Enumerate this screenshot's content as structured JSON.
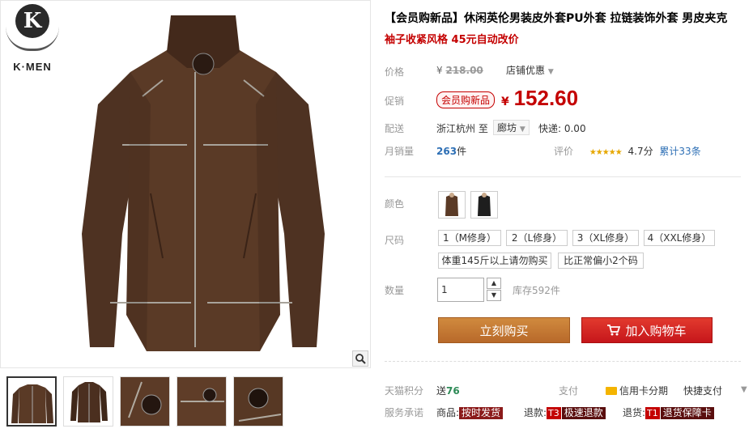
{
  "brand": {
    "logo_letter": "K",
    "logo_text": "K·MEN"
  },
  "product": {
    "title": "【会员购新品】休闲英伦男装皮外套PU外套 拉链装饰外套 男皮夹克",
    "subtitle": "袖子收紧风格 45元自动改价"
  },
  "price": {
    "orig_label": "价格",
    "currency": "¥",
    "orig_value": "218.00",
    "shop_discount": "店铺优惠",
    "promo_label": "促销",
    "promo_tag": "会员购新品",
    "promo_value": "152.60"
  },
  "shipping": {
    "label": "配送",
    "from": "浙江杭州",
    "to_word": "至",
    "to": "廊坊",
    "fee": "快递: 0.00"
  },
  "sales": {
    "label": "月销量",
    "count": "263",
    "unit": "件",
    "rating_label": "评价",
    "stars": "★★★★★",
    "score": "4.7分",
    "reviews": "累计33条"
  },
  "options": {
    "color_label": "颜色",
    "size_label": "尺码",
    "sizes": [
      "1（M修身）",
      "2（L修身）",
      "3（XL修身）",
      "4（XXL修身）",
      "体重145斤以上请勿购买",
      "比正常偏小2个码"
    ],
    "qty_label": "数量",
    "qty_value": "1",
    "stock": "库存592件"
  },
  "actions": {
    "buy_now": "立刻购买",
    "add_cart": "加入购物车"
  },
  "services": {
    "points_label": "天猫积分",
    "points_text": "送",
    "points_value": "76",
    "pay_label": "支付",
    "pay_credit": "信用卡分期",
    "pay_quick": "快捷支付",
    "promise_label": "服务承诺",
    "goods_label": "商品:",
    "goods_badge": "按时发货",
    "refund_label": "退款:",
    "refund_tag": "T3",
    "refund_badge": "极速退款",
    "return_label": "退货:",
    "return_tag": "T1",
    "return_badge": "退货保障卡"
  },
  "colors": {
    "price_red": "#c40000",
    "buy_orange": "#c6782f",
    "cart_red": "#c6161b",
    "jacket_brown": "#5a3a26"
  }
}
